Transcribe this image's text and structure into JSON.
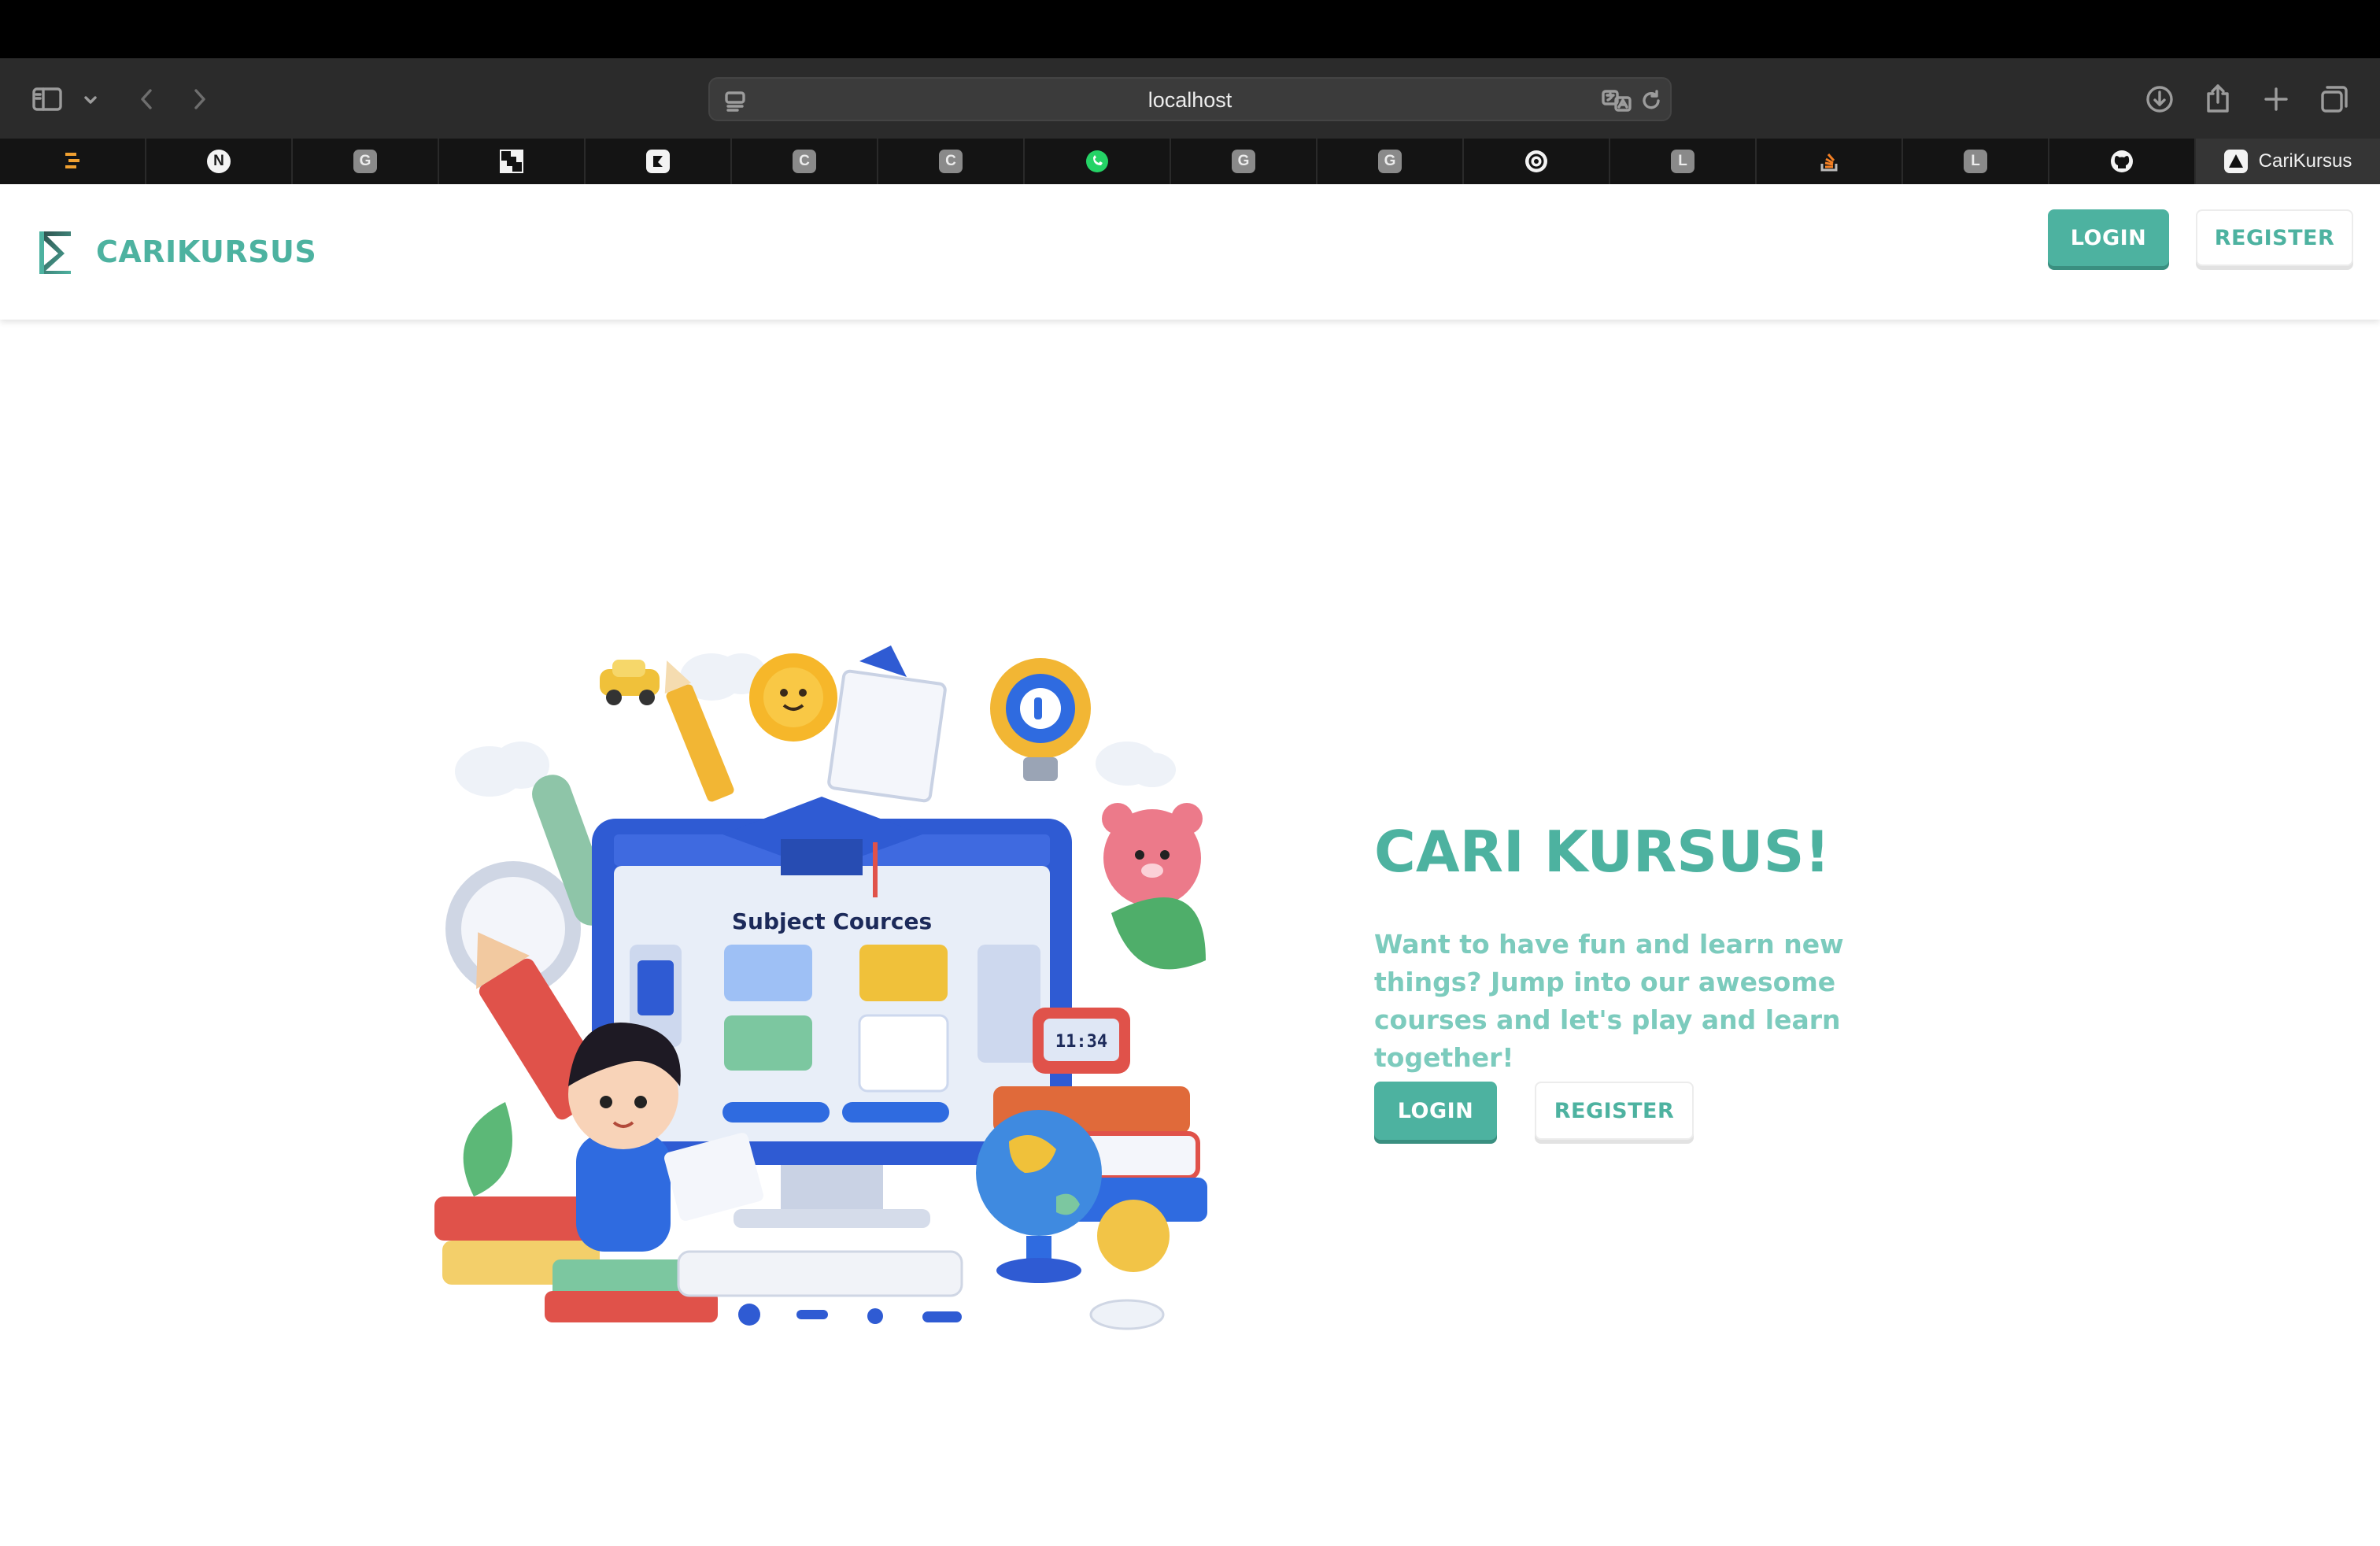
{
  "browser": {
    "url": "localhost",
    "tabs": [
      {
        "icon": "lightning-icon",
        "letter": ""
      },
      {
        "icon": "nextjs-icon",
        "letter": "N"
      },
      {
        "icon": "letter-icon",
        "letter": "G"
      },
      {
        "icon": "checker-icon",
        "letter": ""
      },
      {
        "icon": "app-icon",
        "letter": ""
      },
      {
        "icon": "letter-icon",
        "letter": "C"
      },
      {
        "icon": "letter-icon",
        "letter": "C"
      },
      {
        "icon": "whatsapp-icon",
        "letter": ""
      },
      {
        "icon": "letter-icon",
        "letter": "G"
      },
      {
        "icon": "letter-icon",
        "letter": "G"
      },
      {
        "icon": "openai-icon",
        "letter": ""
      },
      {
        "icon": "letter-icon",
        "letter": "L"
      },
      {
        "icon": "stackoverflow-icon",
        "letter": ""
      },
      {
        "icon": "letter-icon",
        "letter": "L"
      },
      {
        "icon": "github-icon",
        "letter": ""
      }
    ],
    "active_tab_title": "CariKursus"
  },
  "navbar": {
    "brand": "CARIKURSUS",
    "login_label": "LOGIN",
    "register_label": "REGISTER"
  },
  "hero": {
    "title": "CARI KURSUS!",
    "text": "Want to have fun and learn new things? Jump into our awesome courses and let's play and learn together!",
    "login_label": "LOGIN",
    "register_label": "REGISTER",
    "illustration_label": "Subject Cources",
    "clock_readout": "11:34"
  },
  "colors": {
    "accent": "#4db2a0",
    "accent_light": "#7ccbbd"
  }
}
